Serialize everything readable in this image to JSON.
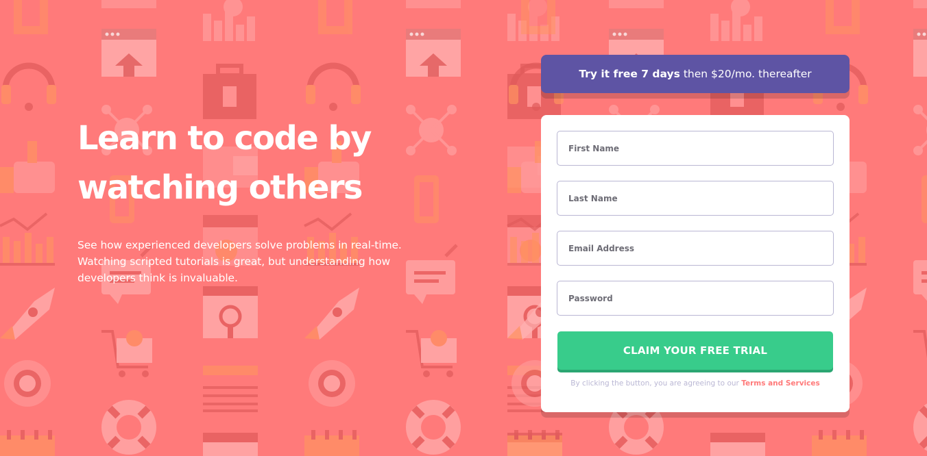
{
  "colors": {
    "background": "#ff7a7a",
    "banner": "#5e54a4",
    "cta": "#38cc8b",
    "cta_shadow": "#2ba672",
    "link": "#ff7a7a",
    "text_dark": "#3d3b48",
    "muted": "#bab7d4"
  },
  "hero": {
    "title_line1": "Learn to code by",
    "title_line2": "watching others",
    "description_line1": "See how experienced developers solve problems in real-time.",
    "description_line2": "Watching scripted tutorials is great, but understanding how",
    "description_line3": "developers think is invaluable."
  },
  "banner": {
    "bold": "Try it free 7 days",
    "rest": "then $20/mo. thereafter"
  },
  "form": {
    "first_name_placeholder": "First Name",
    "last_name_placeholder": "Last Name",
    "email_placeholder": "Email Address",
    "password_placeholder": "Password",
    "submit_label": "CLAIM YOUR FREE TRIAL",
    "terms_text": "By clicking the button, you are agreeing to our ",
    "terms_link": "Terms and Services"
  },
  "background_pattern": {
    "icons": [
      "browser-window-icon",
      "chart-bars-icon",
      "headset-icon",
      "lock-icon",
      "network-icon",
      "thumbs-up-icon",
      "chat-bubble-icon",
      "rocket-icon",
      "cart-icon",
      "globe-gear-icon",
      "lifebuoy-icon",
      "calendar-icon"
    ]
  }
}
